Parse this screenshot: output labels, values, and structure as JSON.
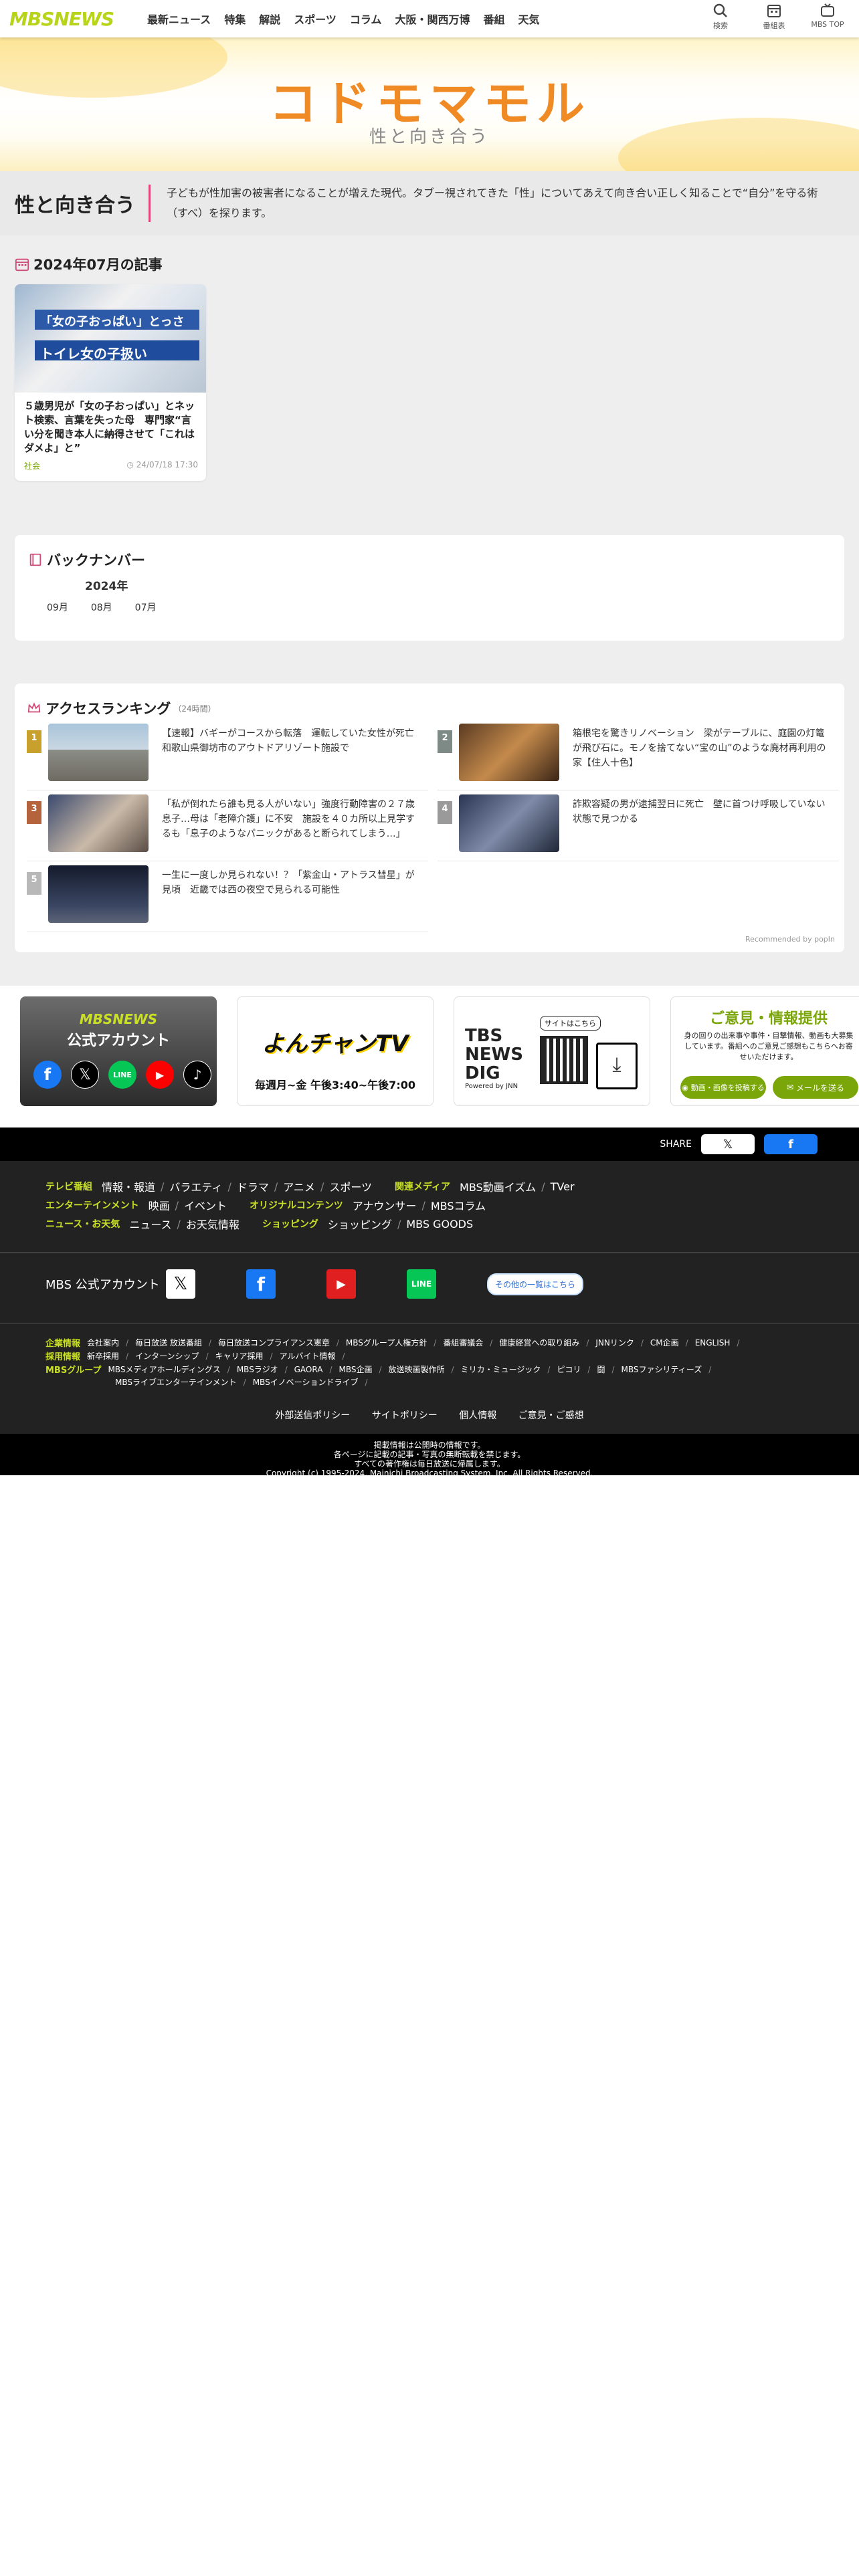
{
  "header": {
    "logo": "MBSNEWS",
    "nav": [
      "最新ニュース",
      "特集",
      "解説",
      "スポーツ",
      "コラム",
      "大阪・関西万博",
      "番組",
      "天気"
    ],
    "right": [
      {
        "icon": "search-icon",
        "label": "検索"
      },
      {
        "icon": "calendar-icon",
        "label": "番組表"
      },
      {
        "icon": "tv-icon",
        "label": "MBS TOP"
      }
    ]
  },
  "banner": {
    "title": "コドモマモル",
    "subtitle": "性と向き合う"
  },
  "intro": {
    "title": "性と向き合う",
    "text": "子どもが性加害の被害者になることが増えた現代。タブー視されてきた「性」についてあえて向き合い正しく知ることで“自分”を守る術（すべ）を探ります。"
  },
  "articles_section": {
    "heading": "2024年07月の記事",
    "items": [
      {
        "thumb_text_1": "「女の子おっぱい」とっさ",
        "thumb_text_2": "トイレ女の子扱い",
        "title": "５歳男児が「女の子おっぱい」とネット検索、言葉を失った母　専門家“言い分を聞き本人に納得させて「これはダメよ」と”",
        "category": "社会",
        "date": "24/07/18 17:30"
      }
    ]
  },
  "backnumber": {
    "heading": "バックナンバー",
    "year": "2024年",
    "months": [
      "09月",
      "08月",
      "07月"
    ]
  },
  "ranking": {
    "heading": "アクセスランキング",
    "sub": "（24時間）",
    "items": [
      {
        "rank": "1",
        "title": "【速報】バギーがコースから転落　運転していた女性が死亡　和歌山県御坊市のアウトドアリゾート施設で"
      },
      {
        "rank": "2",
        "title": "箱根宅を驚きリノベーション　梁がテーブルに、庭園の灯篭が飛び石に。モノを捨てない“宝の山”のような廃材再利用の家【住人十色】"
      },
      {
        "rank": "3",
        "title": "「私が倒れたら誰も見る人がいない」強度行動障害の２７歳息子…母は「老障介護」に不安　施設を４０カ所以上見学するも「息子のようなパニックがあると断られてしまう…」"
      },
      {
        "rank": "4",
        "title": "詐欺容疑の男が逮捕翌日に死亡　壁に首つけ呼吸していない状態で見つかる"
      },
      {
        "rank": "5",
        "title": "一生に一度しか見られない！？「紫金山・アトラス彗星」が見頃　近畿では西の夜空で見られる可能性"
      }
    ],
    "recommended": "Recommended by popIn",
    "rank_colors": [
      "#c8a02c",
      "#7d8a85",
      "#b5633d",
      "#9a9a9a",
      "#b8b8b8"
    ]
  },
  "promos": {
    "p1_title": "MBSNEWS",
    "p1_sub": "公式アカウント",
    "p2_title": "よんチャンTV",
    "p2_time": "毎週月~金 午後3:40~午後7:00",
    "p3_title": "TBS NEWS DIG",
    "p3_sub": "Powered by JNN",
    "p3_tag": "サイトはこちら",
    "p4_title": "ご意見・情報提供",
    "p4_text": "身の回りの出来事や事件・目撃情報、動画も大募集しています。番組へのご意見ご感想もこちらへお寄せいただけます。",
    "p4_btn1": "動画・画像を投稿する",
    "p4_btn2": "メールを送る"
  },
  "footer": {
    "share_label": "SHARE",
    "rows": [
      {
        "cat": "テレビ番組",
        "links": [
          "情報・報道",
          "バラエティ",
          "ドラマ",
          "アニメ",
          "スポーツ"
        ],
        "cat2": "関連メディア",
        "links2": [
          "MBS動画イズム",
          "TVer"
        ]
      },
      {
        "cat": "エンターテインメント",
        "links": [
          "映画",
          "イベント"
        ],
        "cat2": "オリジナルコンテンツ",
        "links2": [
          "アナウンサー",
          "MBSコラム"
        ]
      },
      {
        "cat": "ニュース・お天気",
        "links": [
          "ニュース",
          "お天気情報"
        ],
        "cat2": "ショッピング",
        "links2": [
          "ショッピング",
          "MBS GOODS"
        ]
      }
    ],
    "social_label": "MBS 公式アカウント",
    "social_more": "その他の一覧はこちら",
    "company_cat": "企業情報",
    "company_links": [
      "会社案内",
      "毎日放送 放送番組",
      "毎日放送コンプライアンス憲章",
      "MBSグループ人権方針",
      "番組審議会",
      "健康経営への取り組み",
      "JNNリンク",
      "CM企画",
      "ENGLISH"
    ],
    "recruit_cat": "採用情報",
    "recruit_links": [
      "新卒採用",
      "インターンシップ",
      "キャリア採用",
      "アルバイト情報"
    ],
    "group_cat": "MBSグループ",
    "group_links": [
      "MBSメディアホールディングス",
      "MBSラジオ",
      "GAORA",
      "MBS企画",
      "放送映画製作所",
      "ミリカ・ミュージック",
      "ピコリ",
      "闘",
      "MBSファシリティーズ"
    ],
    "group_links2": [
      "MBSライブエンターテインメント",
      "MBSイノベーションドライブ"
    ],
    "policies": [
      "外部送信ポリシー",
      "サイトポリシー",
      "個人情報",
      "ご意見・ご感想"
    ],
    "copy1": "掲載情報は公開時の情報です。",
    "copy2": "各ページに記載の記事・写真の無断転載を禁じます。",
    "copy3": "すべての著作権は毎日放送に帰属します。",
    "copy4": "Copyright (c) 1995-2024, Mainichi Broadcasting System, Inc. All Rights Reserved."
  }
}
